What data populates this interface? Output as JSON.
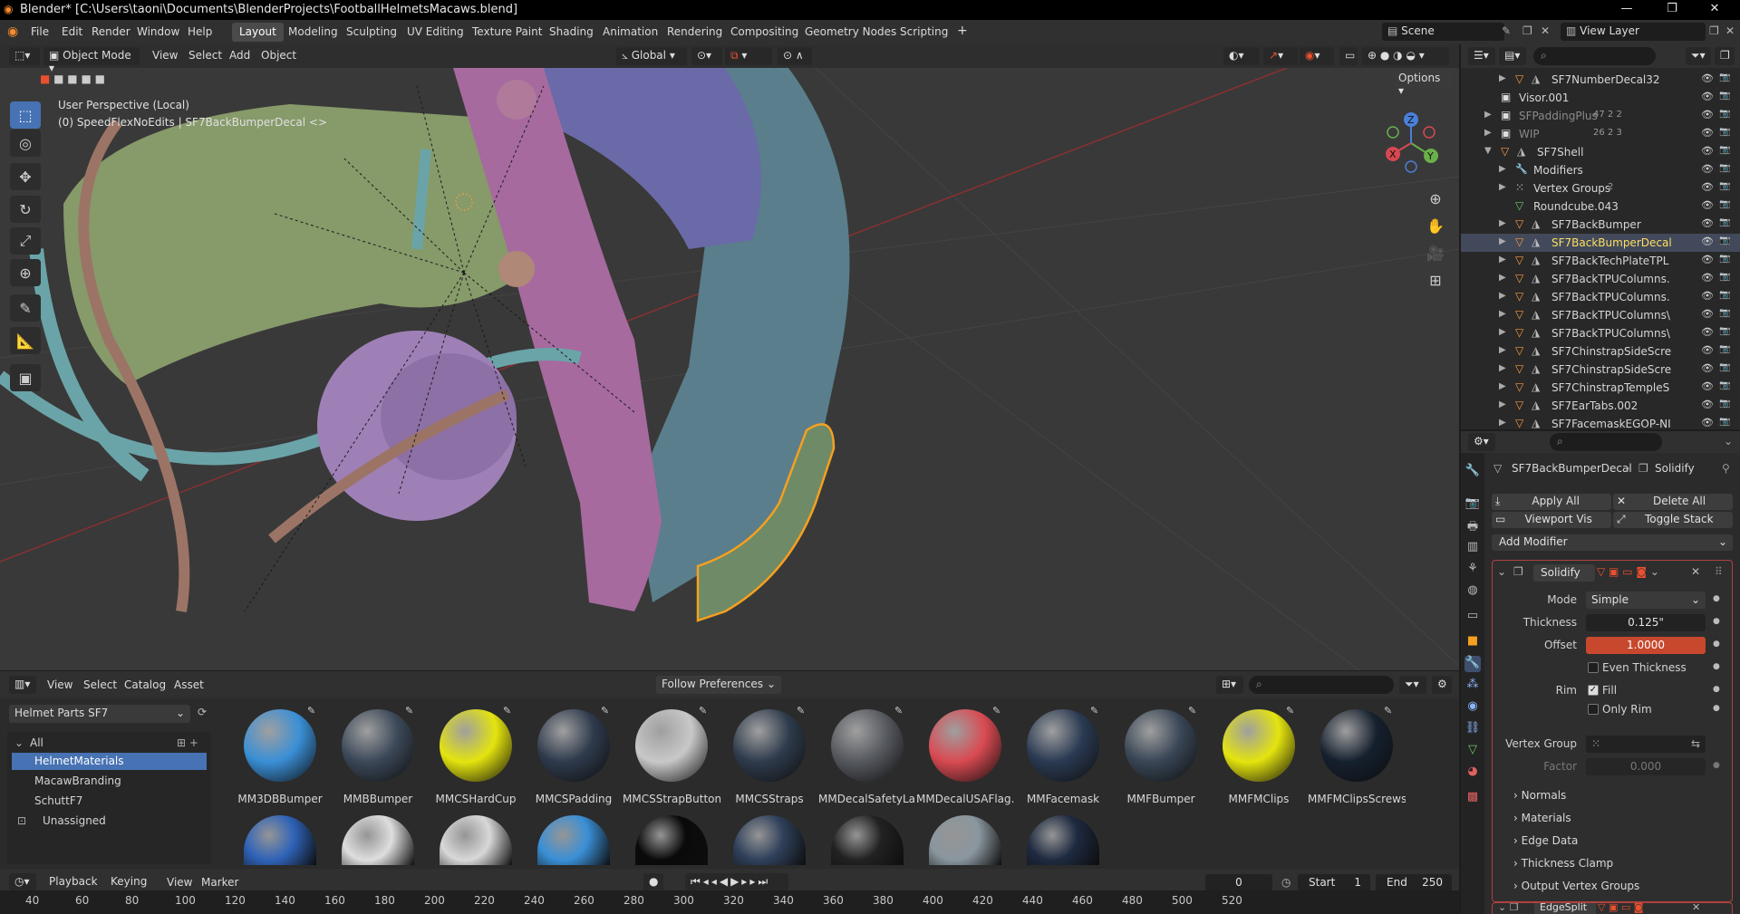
{
  "window": {
    "title": "Blender* [C:\\Users\\taoni\\Documents\\BlenderProjects\\FootballHelmetsMacaws.blend]",
    "minimize": "—",
    "maximize": "❐",
    "close": "✕"
  },
  "menu": [
    "File",
    "Edit",
    "Render",
    "Window",
    "Help"
  ],
  "workspaces": [
    "Layout",
    "Modeling",
    "Sculpting",
    "UV Editing",
    "Texture Paint",
    "Shading",
    "Animation",
    "Rendering",
    "Compositing",
    "Geometry Nodes",
    "Scripting"
  ],
  "scene": "Scene",
  "view_layer": "View Layer",
  "viewport": {
    "mode": "Object Mode",
    "menus": [
      "View",
      "Select",
      "Add",
      "Object"
    ],
    "transform": "Global",
    "options": "Options",
    "info_line1": "User Perspective (Local)",
    "info_line2": "(0) SpeedFlexNoEdits | SF7BackBumperDecal <>",
    "gizmo": {
      "x": "X",
      "y": "Y",
      "z": "Z"
    }
  },
  "outliner": {
    "rows": [
      {
        "name": "SF7NumberDecal32"
      },
      {
        "name": "Visor.001"
      },
      {
        "name": "SFPaddingPlus",
        "extra": "47 2 2"
      },
      {
        "name": "WIP",
        "extra": "26 2 3"
      },
      {
        "name": "SF7Shell"
      },
      {
        "name": "Modifiers"
      },
      {
        "name": "Vertex Groups",
        "extra": "2"
      },
      {
        "name": "Roundcube.043"
      },
      {
        "name": "SF7BackBumper"
      },
      {
        "name": "SF7BackBumperDecal"
      },
      {
        "name": "SF7BackTechPlateTPL"
      },
      {
        "name": "SF7BackTPUColumns."
      },
      {
        "name": "SF7BackTPUColumns."
      },
      {
        "name": "SF7BackTPUColumns\\"
      },
      {
        "name": "SF7BackTPUColumns\\"
      },
      {
        "name": "SF7ChinstrapSideScre"
      },
      {
        "name": "SF7ChinstrapSideScre"
      },
      {
        "name": "SF7ChinstrapTempleS"
      },
      {
        "name": "SF7EarTabs.002"
      },
      {
        "name": "SF7FacemaskEGOP-NI"
      }
    ]
  },
  "properties": {
    "breadcrumb_object": "SF7BackBumperDecal",
    "breadcrumb_modifier": "Solidify",
    "apply_all": "Apply All",
    "delete_all": "Delete All",
    "viewport_vis": "Viewport Vis",
    "toggle_stack": "Toggle Stack",
    "add_modifier": "Add Modifier",
    "modifier_name": "Solidify",
    "mode_label": "Mode",
    "mode_value": "Simple",
    "thickness_label": "Thickness",
    "thickness_value": "0.125\"",
    "offset_label": "Offset",
    "offset_value": "1.0000",
    "even_thickness": "Even Thickness",
    "rim_label": "Rim",
    "fill": "Fill",
    "only_rim": "Only Rim",
    "vertex_group_label": "Vertex Group",
    "factor_label": "Factor",
    "factor_value": "0.000",
    "sections": [
      "Normals",
      "Materials",
      "Edge Data",
      "Thickness Clamp",
      "Output Vertex Groups"
    ],
    "next_modifier": "EdgeSplit"
  },
  "asset_browser": {
    "menus": [
      "View",
      "Select",
      "Catalog",
      "Asset"
    ],
    "import_method": "Follow Preferences",
    "library": "Helmet Parts SF7",
    "catalogs": [
      "All",
      "HelmetMaterials",
      "MacawBranding",
      "SchuttF7",
      "Unassigned"
    ],
    "materials": [
      {
        "name": "MM3DBBumper",
        "color": "#3a8fd6"
      },
      {
        "name": "MMBBumper",
        "color": "#3b4858"
      },
      {
        "name": "MMCSHardCup",
        "color": "#e4e40f"
      },
      {
        "name": "MMCSPadding",
        "color": "#2e3a4c"
      },
      {
        "name": "MMCSStrapButtons",
        "color": "#c8c8c8"
      },
      {
        "name": "MMCSStraps",
        "color": "#2e3b4c"
      },
      {
        "name": "MMDecalSafetyLa...",
        "color": "#55585e"
      },
      {
        "name": "MMDecalUSAFlag...",
        "color": "#d94a52"
      },
      {
        "name": "MMFacemask",
        "color": "#2a3a52"
      },
      {
        "name": "MMFBumper",
        "color": "#394656"
      },
      {
        "name": "MMFMClips",
        "color": "#e4e40f"
      },
      {
        "name": "MMFMClipsScrews",
        "color": "#15202e"
      }
    ],
    "row2_colors": [
      "#2f63b8",
      "#dedede",
      "#d8d8d8",
      "#3a8fd6",
      "#0a0a0a",
      "#2f405a",
      "#222",
      "#8a969e",
      "#1e2a40"
    ]
  },
  "timeline": {
    "menus": [
      "Playback",
      "Keying",
      "View",
      "Marker"
    ],
    "current_frame": "0",
    "start_label": "Start",
    "start": "1",
    "end_label": "End",
    "end": "250",
    "ticks": [
      "40",
      "60",
      "80",
      "100",
      "120",
      "140",
      "160",
      "180",
      "200",
      "220",
      "240",
      "260",
      "280",
      "300",
      "320",
      "340",
      "360",
      "380",
      "400",
      "420",
      "440",
      "460",
      "480",
      "500",
      "520"
    ]
  }
}
